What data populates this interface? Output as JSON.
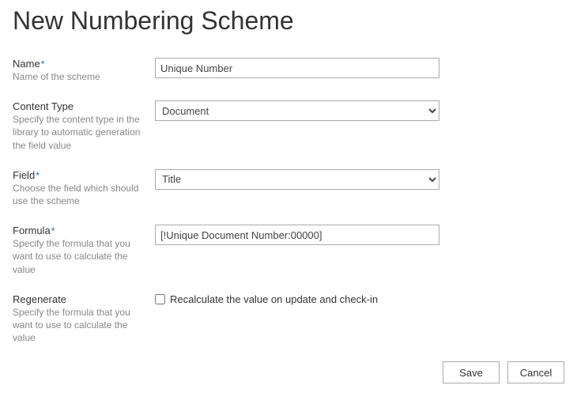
{
  "title": "New Numbering Scheme",
  "fields": {
    "name": {
      "label": "Name",
      "required": true,
      "description": "Name of the scheme",
      "value": "Unique Number"
    },
    "contentType": {
      "label": "Content Type",
      "required": false,
      "description": "Specify the content type in the library to automatic generation the field value",
      "value": "Document"
    },
    "field": {
      "label": "Field",
      "required": true,
      "description": "Choose the field which should use the scheme",
      "value": "Title"
    },
    "formula": {
      "label": "Formula",
      "required": true,
      "description": "Specify the formula that you want to use to calculate the value",
      "value": "[!Unique Document Number:00000]"
    },
    "regenerate": {
      "label": "Regenerate",
      "required": false,
      "description": "Specify the formula that you want to use to calculate the value",
      "checkboxLabel": "Recalculate the value on update and check-in",
      "checked": false
    }
  },
  "buttons": {
    "save": "Save",
    "cancel": "Cancel"
  }
}
